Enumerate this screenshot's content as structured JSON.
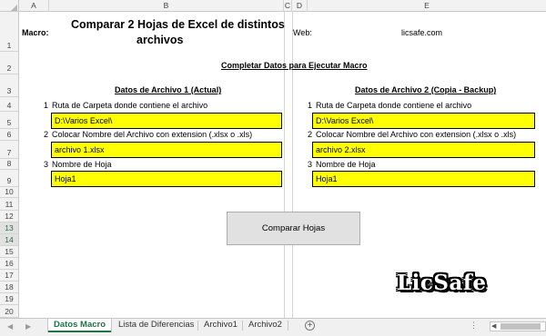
{
  "columns": [
    "A",
    "B",
    "C",
    "D",
    "E"
  ],
  "rows": [
    "1",
    "2",
    "3",
    "4",
    "5",
    "6",
    "7",
    "8",
    "9",
    "10",
    "11",
    "12",
    "13",
    "14",
    "15",
    "16",
    "17",
    "18",
    "19",
    "20"
  ],
  "selected_rows": [
    "13",
    "14"
  ],
  "header": {
    "macro_label": "Macro:",
    "title_line1": "Comparar 2 Hojas de Excel de distintos",
    "title_line2": "archivos",
    "web_label": "Web:",
    "web_value": "licsafe.com"
  },
  "section_title": "Completar Datos para Ejecutar Macro",
  "file1": {
    "heading": "Datos de Archivo 1 (Actual)",
    "step1_num": "1",
    "step1_label": "Ruta de Carpeta donde contiene el archivo",
    "step1_value": "D:\\Varios Excel\\",
    "step2_num": "2",
    "step2_label": "Colocar Nombre del Archivo con extension (.xlsx o .xls)",
    "step2_value": "archivo 1.xlsx",
    "step3_num": "3",
    "step3_label": "Nombre de Hoja",
    "step3_value": "Hoja1"
  },
  "file2": {
    "heading": "Datos de Archivo 2 (Copia - Backup)",
    "step1_num": "1",
    "step1_label": "Ruta de Carpeta donde contiene el archivo",
    "step1_value": "D:\\Varios Excel\\",
    "step2_num": "2",
    "step2_label": "Colocar Nombre del Archivo con extension (.xlsx o .xls)",
    "step2_value": "archivo 2.xlsx",
    "step3_num": "3",
    "step3_label": "Nombre de Hoja",
    "step3_value": "Hoja1"
  },
  "compare_button": "Comparar Hojas",
  "logo_text": "LicSafe",
  "tabs": [
    "Datos Macro",
    "Lista de Diferencias",
    "Archivo1",
    "Archivo2"
  ],
  "active_tab": "Datos Macro",
  "colors": {
    "input_fill": "#ffff00",
    "excel_green": "#217346"
  },
  "icons": {
    "prev_sheet": "triangle-left-icon",
    "next_sheet": "triangle-right-icon",
    "add_sheet": "plus-circle-icon",
    "more": "ellipsis-icon",
    "scroll_left": "triangle-left-icon"
  }
}
